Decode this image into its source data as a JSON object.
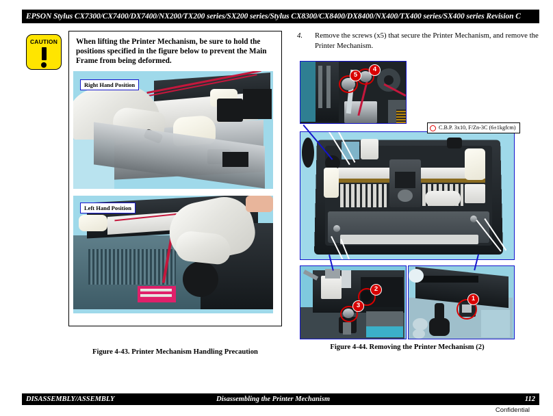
{
  "header": {
    "title": "EPSON Stylus CX7300/CX7400/DX7400/NX200/TX200 series/SX200 series/Stylus CX8300/CX8400/DX8400/NX400/TX400 series/SX400 series  Revision C"
  },
  "caution": {
    "icon_label": "CAUTION",
    "text": "When lifting the Printer Mechanism, be sure to hold the positions specified in the figure below to prevent the Main Frame from being deformed.",
    "photo_labels": {
      "top": "Right Hand Position",
      "bottom": "Left Hand Position"
    }
  },
  "figures": {
    "left_caption": "Figure 4-43.  Printer Mechanism Handling Precaution",
    "right_caption": "Figure 4-44.  Removing the Printer Mechanism (2)"
  },
  "steps": [
    {
      "number": "4.",
      "text": "Remove the screws (x5) that secure the Printer Mechanism, and remove the Printer Mechanism."
    }
  ],
  "screw_spec": {
    "icon": "red-circle-icon",
    "text": "C.B.P. 3x10, F/Zn-3C (6±1kgfcm)"
  },
  "callouts": {
    "top_photo": [
      "5",
      "4"
    ],
    "bottom_left_photo": [
      "2",
      "3"
    ],
    "bottom_right_photo": [
      "1"
    ]
  },
  "footer": {
    "left": "DISASSEMBLY/ASSEMBLY",
    "middle": "Disassembling the Printer Mechanism",
    "page": "112",
    "confidential": "Confidential"
  },
  "colors": {
    "header_bg": "#000000",
    "caution_yellow": "#ffe500",
    "callout_red": "#d80000",
    "photo_border_blue": "#1414cc",
    "photo_bg_cyan": "#9fd9ea"
  }
}
